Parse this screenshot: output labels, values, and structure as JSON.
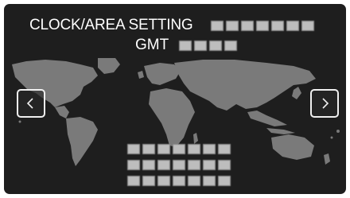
{
  "header": {
    "title": "CLOCK/AREA SETTING",
    "gmt_label": "GMT"
  },
  "navigation": {
    "prev_icon": "chevron-left-icon",
    "next_icon": "chevron-right-icon"
  },
  "colors": {
    "screen_background": "#1e1e1e",
    "map_land": "#7a7a7a",
    "text": "#ffffff"
  }
}
